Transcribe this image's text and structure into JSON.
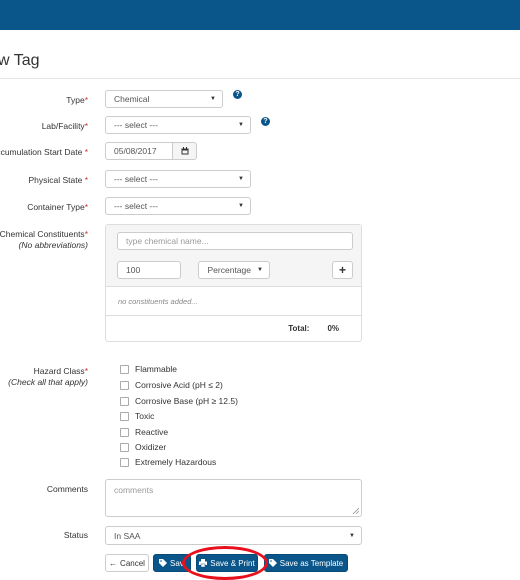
{
  "page": {
    "title": "w Tag"
  },
  "form": {
    "type": {
      "label": "Type",
      "value": "Chemical"
    },
    "lab": {
      "label": "Lab/Facility",
      "value": "--- select ---"
    },
    "start_date": {
      "label": "Accumulation Start Date",
      "value": "05/08/2017"
    },
    "physical_state": {
      "label": "Physical State",
      "value": "--- select ---"
    },
    "container_type": {
      "label": "Container Type",
      "value": "--- select ---"
    },
    "constituents": {
      "label": "Chemical Constituents",
      "sublabel": "(No abbreviations)",
      "name_placeholder": "type chemical name...",
      "amount": "100",
      "unit": "Percentage",
      "empty_text": "no constituents added...",
      "total_label": "Total:",
      "total_value": "0%"
    },
    "hazard": {
      "label": "Hazard Class",
      "sublabel": "(Check all that apply)",
      "options": [
        "Flammable",
        "Corrosive Acid (pH ≤ 2)",
        "Corrosive Base (pH ≥ 12.5)",
        "Toxic",
        "Reactive",
        "Oxidizer",
        "Extremely Hazardous"
      ]
    },
    "comments": {
      "label": "Comments",
      "placeholder": "comments"
    },
    "status": {
      "label": "Status",
      "value": "In SAA"
    }
  },
  "buttons": {
    "cancel": "Cancel",
    "save": "Sav",
    "save_print": "Save & Print",
    "save_template": "Save as Template"
  },
  "icons": {
    "help": "question-circle-icon",
    "calendar": "calendar-icon",
    "plus": "plus-icon",
    "back": "arrow-left-icon",
    "tag": "tag-icon",
    "print": "print-icon"
  },
  "colors": {
    "brand": "#0a5589",
    "required": "#c9302c",
    "highlight": "#e8101c"
  }
}
